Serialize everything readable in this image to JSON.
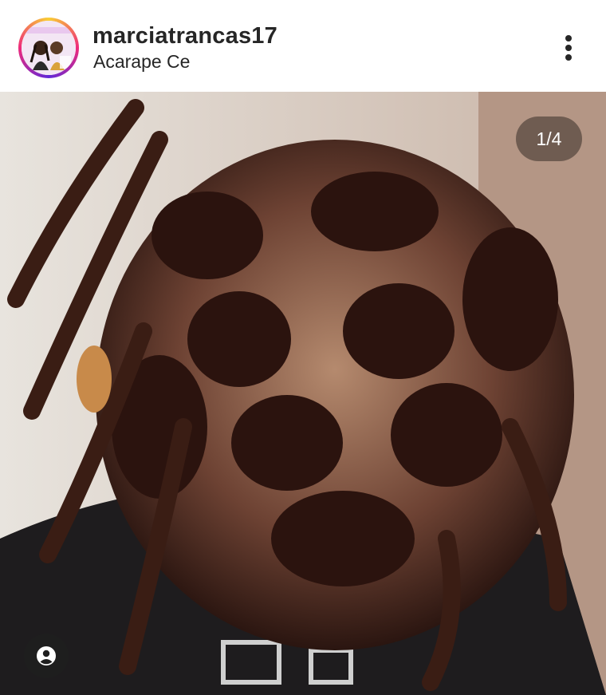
{
  "post": {
    "username": "marciatrancas17",
    "location": "Acarape Ce",
    "photo_counter": "1/4"
  },
  "icons": {
    "more": "more-vertical-icon",
    "tag": "user-tag-icon"
  },
  "colors": {
    "story_ring": [
      "#f9ce34",
      "#ee2a7b",
      "#6228d7"
    ],
    "text": "#262626"
  }
}
